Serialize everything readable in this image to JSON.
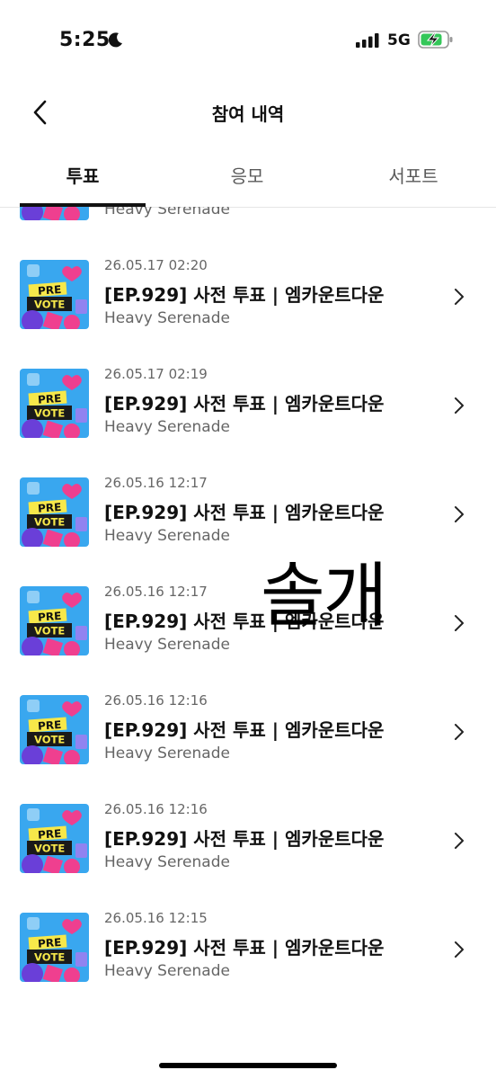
{
  "status_bar": {
    "time": "5:25",
    "network": "5G",
    "icons": [
      "moon-icon",
      "signal-icon",
      "battery-charging-icon"
    ]
  },
  "header": {
    "title": "참여 내역",
    "back_icon": "chevron-left-icon"
  },
  "tabs": [
    {
      "label": "투표",
      "active": true
    },
    {
      "label": "응모",
      "active": false
    },
    {
      "label": "서포트",
      "active": false
    }
  ],
  "thumbnail": {
    "line1": "PRE",
    "line2": "VOTE",
    "colors": {
      "bg": "#39a7ef",
      "band": "#1a1a1a",
      "text": "#f7e84a",
      "pink": "#ef3f8f",
      "purple": "#6a3fd8"
    }
  },
  "partial_row": {
    "subtitle": "Heavy Serenade"
  },
  "items": [
    {
      "date": "26.05.17 02:20",
      "title": "[EP.929] 사전 투표 | 엠카운트다운",
      "subtitle": "Heavy Serenade"
    },
    {
      "date": "26.05.17 02:19",
      "title": "[EP.929] 사전 투표 | 엠카운트다운",
      "subtitle": "Heavy Serenade"
    },
    {
      "date": "26.05.16 12:17",
      "title": "[EP.929] 사전 투표 | 엠카운트다운",
      "subtitle": "Heavy Serenade"
    },
    {
      "date": "26.05.16 12:17",
      "title": "[EP.929] 사전 투표 | 엠카운트다운",
      "subtitle": "Heavy Serenade"
    },
    {
      "date": "26.05.16 12:16",
      "title": "[EP.929] 사전 투표 | 엠카운트다운",
      "subtitle": "Heavy Serenade"
    },
    {
      "date": "26.05.16 12:16",
      "title": "[EP.929] 사전 투표 | 엠카운트다운",
      "subtitle": "Heavy Serenade"
    },
    {
      "date": "26.05.16 12:15",
      "title": "[EP.929] 사전 투표 | 엠카운트다운",
      "subtitle": "Heavy Serenade"
    }
  ],
  "overlay_text": "솔개",
  "row_chevron_icon": "chevron-right-icon"
}
